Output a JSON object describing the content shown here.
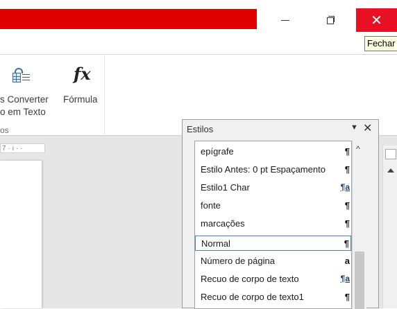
{
  "window": {
    "minimize_glyph": "—",
    "close_glyph": "✕",
    "close_tooltip": "Fechar"
  },
  "ribbon": {
    "buttons": [
      {
        "label_line1": "s Converter",
        "label_line2": "o em Texto",
        "icon": "table-to-text-icon"
      },
      {
        "label_line1": "Fórmula",
        "label_line2": "",
        "icon": "fx-icon",
        "icon_text": "fx"
      }
    ],
    "group_label": "os"
  },
  "ruler": {
    "text": "7 · ı · ·"
  },
  "styles_pane": {
    "title": "Estilos",
    "options_glyph": "▼",
    "close_glyph": "✕",
    "scroll_up_glyph": "^",
    "items": [
      {
        "name": "epígrafe",
        "mark": "¶",
        "selected": false
      },
      {
        "name": "Estilo Antes:  0 pt Espaçamento",
        "mark": "¶",
        "selected": false
      },
      {
        "name": "Estilo1 Char",
        "mark": "¶a",
        "selected": false
      },
      {
        "name": "fonte",
        "mark": "¶",
        "selected": false
      },
      {
        "name": "marcações",
        "mark": "¶",
        "selected": false
      },
      {
        "name": "Normal",
        "mark": "¶",
        "selected": true
      },
      {
        "name": "Número de página",
        "mark": "a",
        "selected": false
      },
      {
        "name": "Recuo de corpo de texto",
        "mark": "¶a",
        "selected": false
      },
      {
        "name": "Recuo de corpo de texto1",
        "mark": "¶",
        "selected": false
      }
    ]
  }
}
